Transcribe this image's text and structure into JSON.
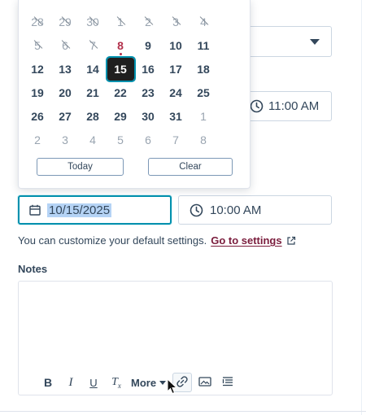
{
  "form": {
    "end_time": "11:00 AM",
    "start_date": "10/15/2025",
    "start_time": "10:00 AM",
    "hint_text": "You can customize your default settings.",
    "settings_link": "Go to settings",
    "notes_label": "Notes"
  },
  "calendar": {
    "weeks": [
      [
        {
          "d": "28",
          "s": "disabled"
        },
        {
          "d": "29",
          "s": "disabled"
        },
        {
          "d": "30",
          "s": "disabled"
        },
        {
          "d": "1",
          "s": "disabled"
        },
        {
          "d": "2",
          "s": "disabled"
        },
        {
          "d": "3",
          "s": "disabled"
        },
        {
          "d": "4",
          "s": "disabled"
        }
      ],
      [
        {
          "d": "5",
          "s": "disabled"
        },
        {
          "d": "6",
          "s": "disabled"
        },
        {
          "d": "7",
          "s": "disabled"
        },
        {
          "d": "8",
          "s": "today"
        },
        {
          "d": "9",
          "s": ""
        },
        {
          "d": "10",
          "s": ""
        },
        {
          "d": "11",
          "s": ""
        }
      ],
      [
        {
          "d": "12",
          "s": ""
        },
        {
          "d": "13",
          "s": ""
        },
        {
          "d": "14",
          "s": ""
        },
        {
          "d": "15",
          "s": "selected"
        },
        {
          "d": "16",
          "s": ""
        },
        {
          "d": "17",
          "s": ""
        },
        {
          "d": "18",
          "s": ""
        }
      ],
      [
        {
          "d": "19",
          "s": ""
        },
        {
          "d": "20",
          "s": ""
        },
        {
          "d": "21",
          "s": ""
        },
        {
          "d": "22",
          "s": ""
        },
        {
          "d": "23",
          "s": ""
        },
        {
          "d": "24",
          "s": ""
        },
        {
          "d": "25",
          "s": ""
        }
      ],
      [
        {
          "d": "26",
          "s": ""
        },
        {
          "d": "27",
          "s": ""
        },
        {
          "d": "28",
          "s": ""
        },
        {
          "d": "29",
          "s": ""
        },
        {
          "d": "30",
          "s": ""
        },
        {
          "d": "31",
          "s": ""
        },
        {
          "d": "1",
          "s": "muted"
        }
      ],
      [
        {
          "d": "2",
          "s": "muted"
        },
        {
          "d": "3",
          "s": "muted"
        },
        {
          "d": "4",
          "s": "muted"
        },
        {
          "d": "5",
          "s": "muted"
        },
        {
          "d": "6",
          "s": "muted"
        },
        {
          "d": "7",
          "s": "muted"
        },
        {
          "d": "8",
          "s": "muted"
        }
      ]
    ],
    "today_label": "Today",
    "clear_label": "Clear"
  },
  "toolbar": {
    "bold": "B",
    "italic": "I",
    "underline": "U",
    "clear_format": "T",
    "clear_format_sub": "x",
    "more_label": "More",
    "icons": [
      "link-icon",
      "image-icon",
      "signature-icon"
    ]
  },
  "colors": {
    "accent": "#0091ae",
    "text": "#33475b",
    "link": "#7a1c3c",
    "today": "#b2304b",
    "selected_bg": "#1f1f1f",
    "selection_highlight": "#b5d3f5"
  }
}
